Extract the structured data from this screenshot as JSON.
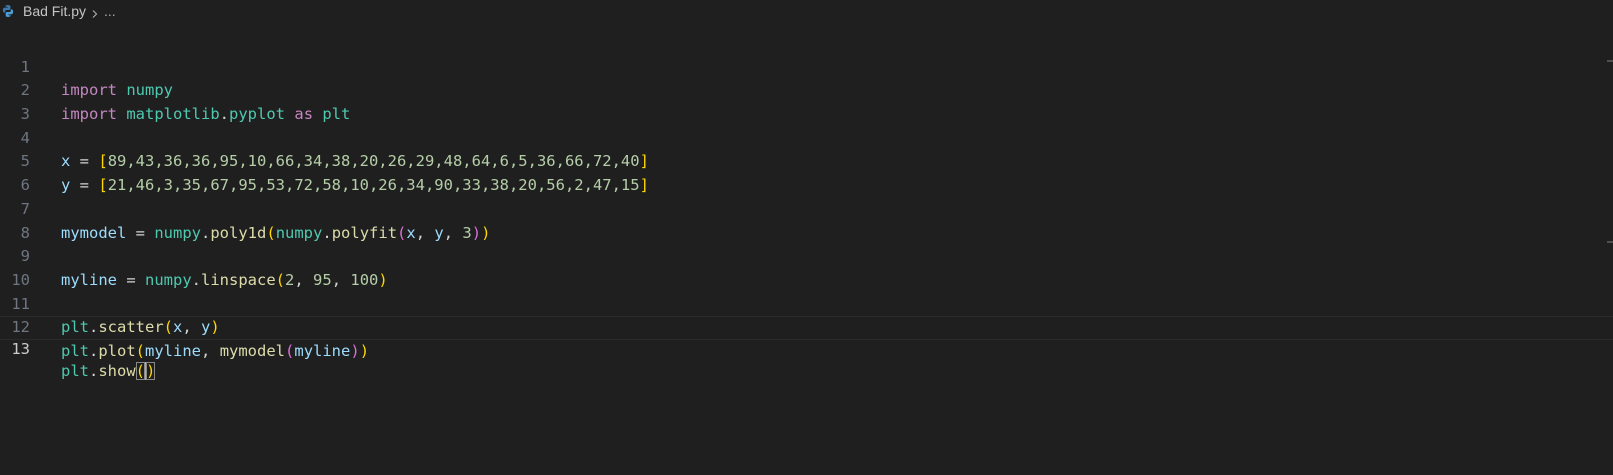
{
  "breadcrumb": {
    "file_name": "Bad Fit.py",
    "ellipsis": "...",
    "file_icon": "python-icon",
    "separator_icon": "chevron-right-icon"
  },
  "editor": {
    "current_line": "13",
    "line_numbers": [
      "1",
      "2",
      "3",
      "4",
      "5",
      "6",
      "7",
      "8",
      "9",
      "10",
      "11",
      "12",
      "13"
    ],
    "tokens": {
      "l1": [
        "import",
        " ",
        "numpy"
      ],
      "l2": [
        "import",
        " ",
        "matplotlib",
        ".",
        "pyplot",
        " ",
        "as",
        " ",
        "plt"
      ],
      "l4": [
        "x",
        " = ",
        "[",
        "89,43,36,36,95,10,66,34,38,20,26,29,48,64,6,5,36,66,72,40",
        "]"
      ],
      "l5": [
        "y",
        " = ",
        "[",
        "21,46,3,35,67,95,53,72,58,10,26,34,90,33,38,20,56,2,47,15",
        "]"
      ],
      "l7": [
        "mymodel",
        " = ",
        "numpy",
        ".",
        "poly1d",
        "(",
        "numpy",
        ".",
        "polyfit",
        "(",
        "x",
        ", ",
        "y",
        ", ",
        "3",
        ")",
        ")"
      ],
      "l9": [
        "myline",
        " = ",
        "numpy",
        ".",
        "linspace",
        "(",
        "2",
        ", ",
        "95",
        ", ",
        "100",
        ")"
      ],
      "l11": [
        "plt",
        ".",
        "scatter",
        "(",
        "x",
        ", ",
        "y",
        ")"
      ],
      "l12": [
        "plt",
        ".",
        "plot",
        "(",
        "myline",
        ", ",
        "mymodel",
        "(",
        "myline",
        ")",
        ")"
      ],
      "l13": [
        "plt",
        ".",
        "show",
        "(",
        ")"
      ]
    }
  }
}
